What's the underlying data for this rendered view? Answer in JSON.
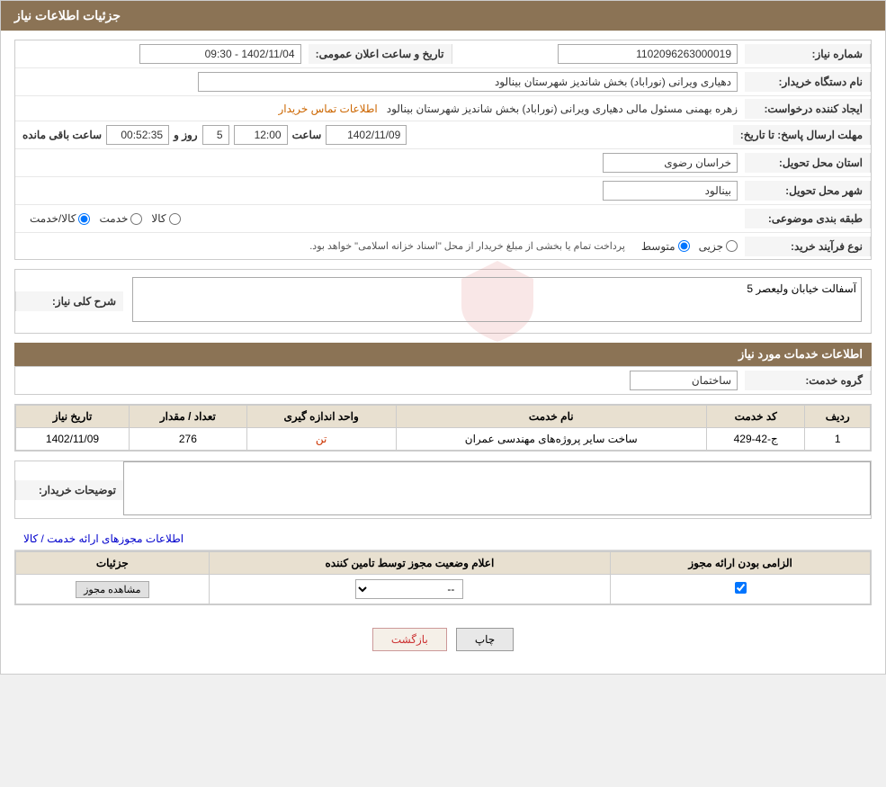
{
  "page": {
    "title": "جزئیات اطلاعات نیاز",
    "header": {
      "label": "جزئیات اطلاعات نیاز"
    }
  },
  "fields": {
    "need_number_label": "شماره نیاز:",
    "need_number_value": "1102096263000019",
    "buyer_agency_label": "نام دستگاه خریدار:",
    "buyer_agency_value": "دهیاری ویرانی (نوراباد) بخش شاندیز شهرستان بینالود",
    "requester_label": "ایجاد کننده درخواست:",
    "requester_value": "زهره بهمنی مسئول مالی دهیاری ویرانی (نوراباد) بخش شاندیز شهرستان بینالود",
    "contact_info_label": "اطلاعات تماس خریدار",
    "announcement_date_label": "تاریخ و ساعت اعلان عمومی:",
    "announcement_date_value": "1402/11/04 - 09:30",
    "response_deadline_label": "مهلت ارسال پاسخ: تا تاریخ:",
    "response_deadline_date": "1402/11/09",
    "response_deadline_time": "12:00",
    "response_deadline_days": "5",
    "response_deadline_days_label": "روز و",
    "response_deadline_remaining": "00:52:35",
    "response_deadline_remaining_label": "ساعت باقی مانده",
    "delivery_province_label": "استان محل تحویل:",
    "delivery_province_value": "خراسان رضوی",
    "delivery_city_label": "شهر محل تحویل:",
    "delivery_city_value": "بینالود",
    "category_label": "طبقه بندی موضوعی:",
    "category_goods": "کالا",
    "category_service": "خدمت",
    "category_goods_service": "کالا/خدمت",
    "purchase_type_label": "نوع فرآیند خرید:",
    "purchase_type_partial": "جزیی",
    "purchase_type_medium": "متوسط",
    "purchase_note": "پرداخت تمام یا بخشی از مبلغ خریدار از محل \"اسناد خزانه اسلامی\" خواهد بود.",
    "need_description_label": "شرح کلی نیاز:",
    "need_description_value": "آسفالت خیابان ولیعصر 5",
    "services_section_title": "اطلاعات خدمات مورد نیاز",
    "service_group_label": "گروه خدمت:",
    "service_group_value": "ساختمان",
    "table_headers": {
      "row_num": "ردیف",
      "service_code": "کد خدمت",
      "service_name": "نام خدمت",
      "unit": "واحد اندازه گیری",
      "quantity": "تعداد / مقدار",
      "need_date": "تاریخ نیاز"
    },
    "table_rows": [
      {
        "row": "1",
        "code": "ج-42-429",
        "name": "ساخت سایر پروژه‌های مهندسی عمران",
        "unit": "تن",
        "quantity": "276",
        "date": "1402/11/09"
      }
    ],
    "buyer_notes_label": "توضیحات خریدار:",
    "buyer_notes_value": "",
    "permissions_section_title": "اطلاعات مجوزهای ارائه خدمت / کالا",
    "permissions_table_headers": {
      "required": "الزامی بودن ارائه مجوز",
      "status_announcement": "اعلام وضعیت مجوز توسط تامین کننده",
      "details": "جزئیات"
    },
    "permissions_rows": [
      {
        "required_checked": true,
        "status_value": "--",
        "view_btn_label": "مشاهده مجوز"
      }
    ],
    "buttons": {
      "print": "چاپ",
      "back": "بازگشت"
    }
  }
}
